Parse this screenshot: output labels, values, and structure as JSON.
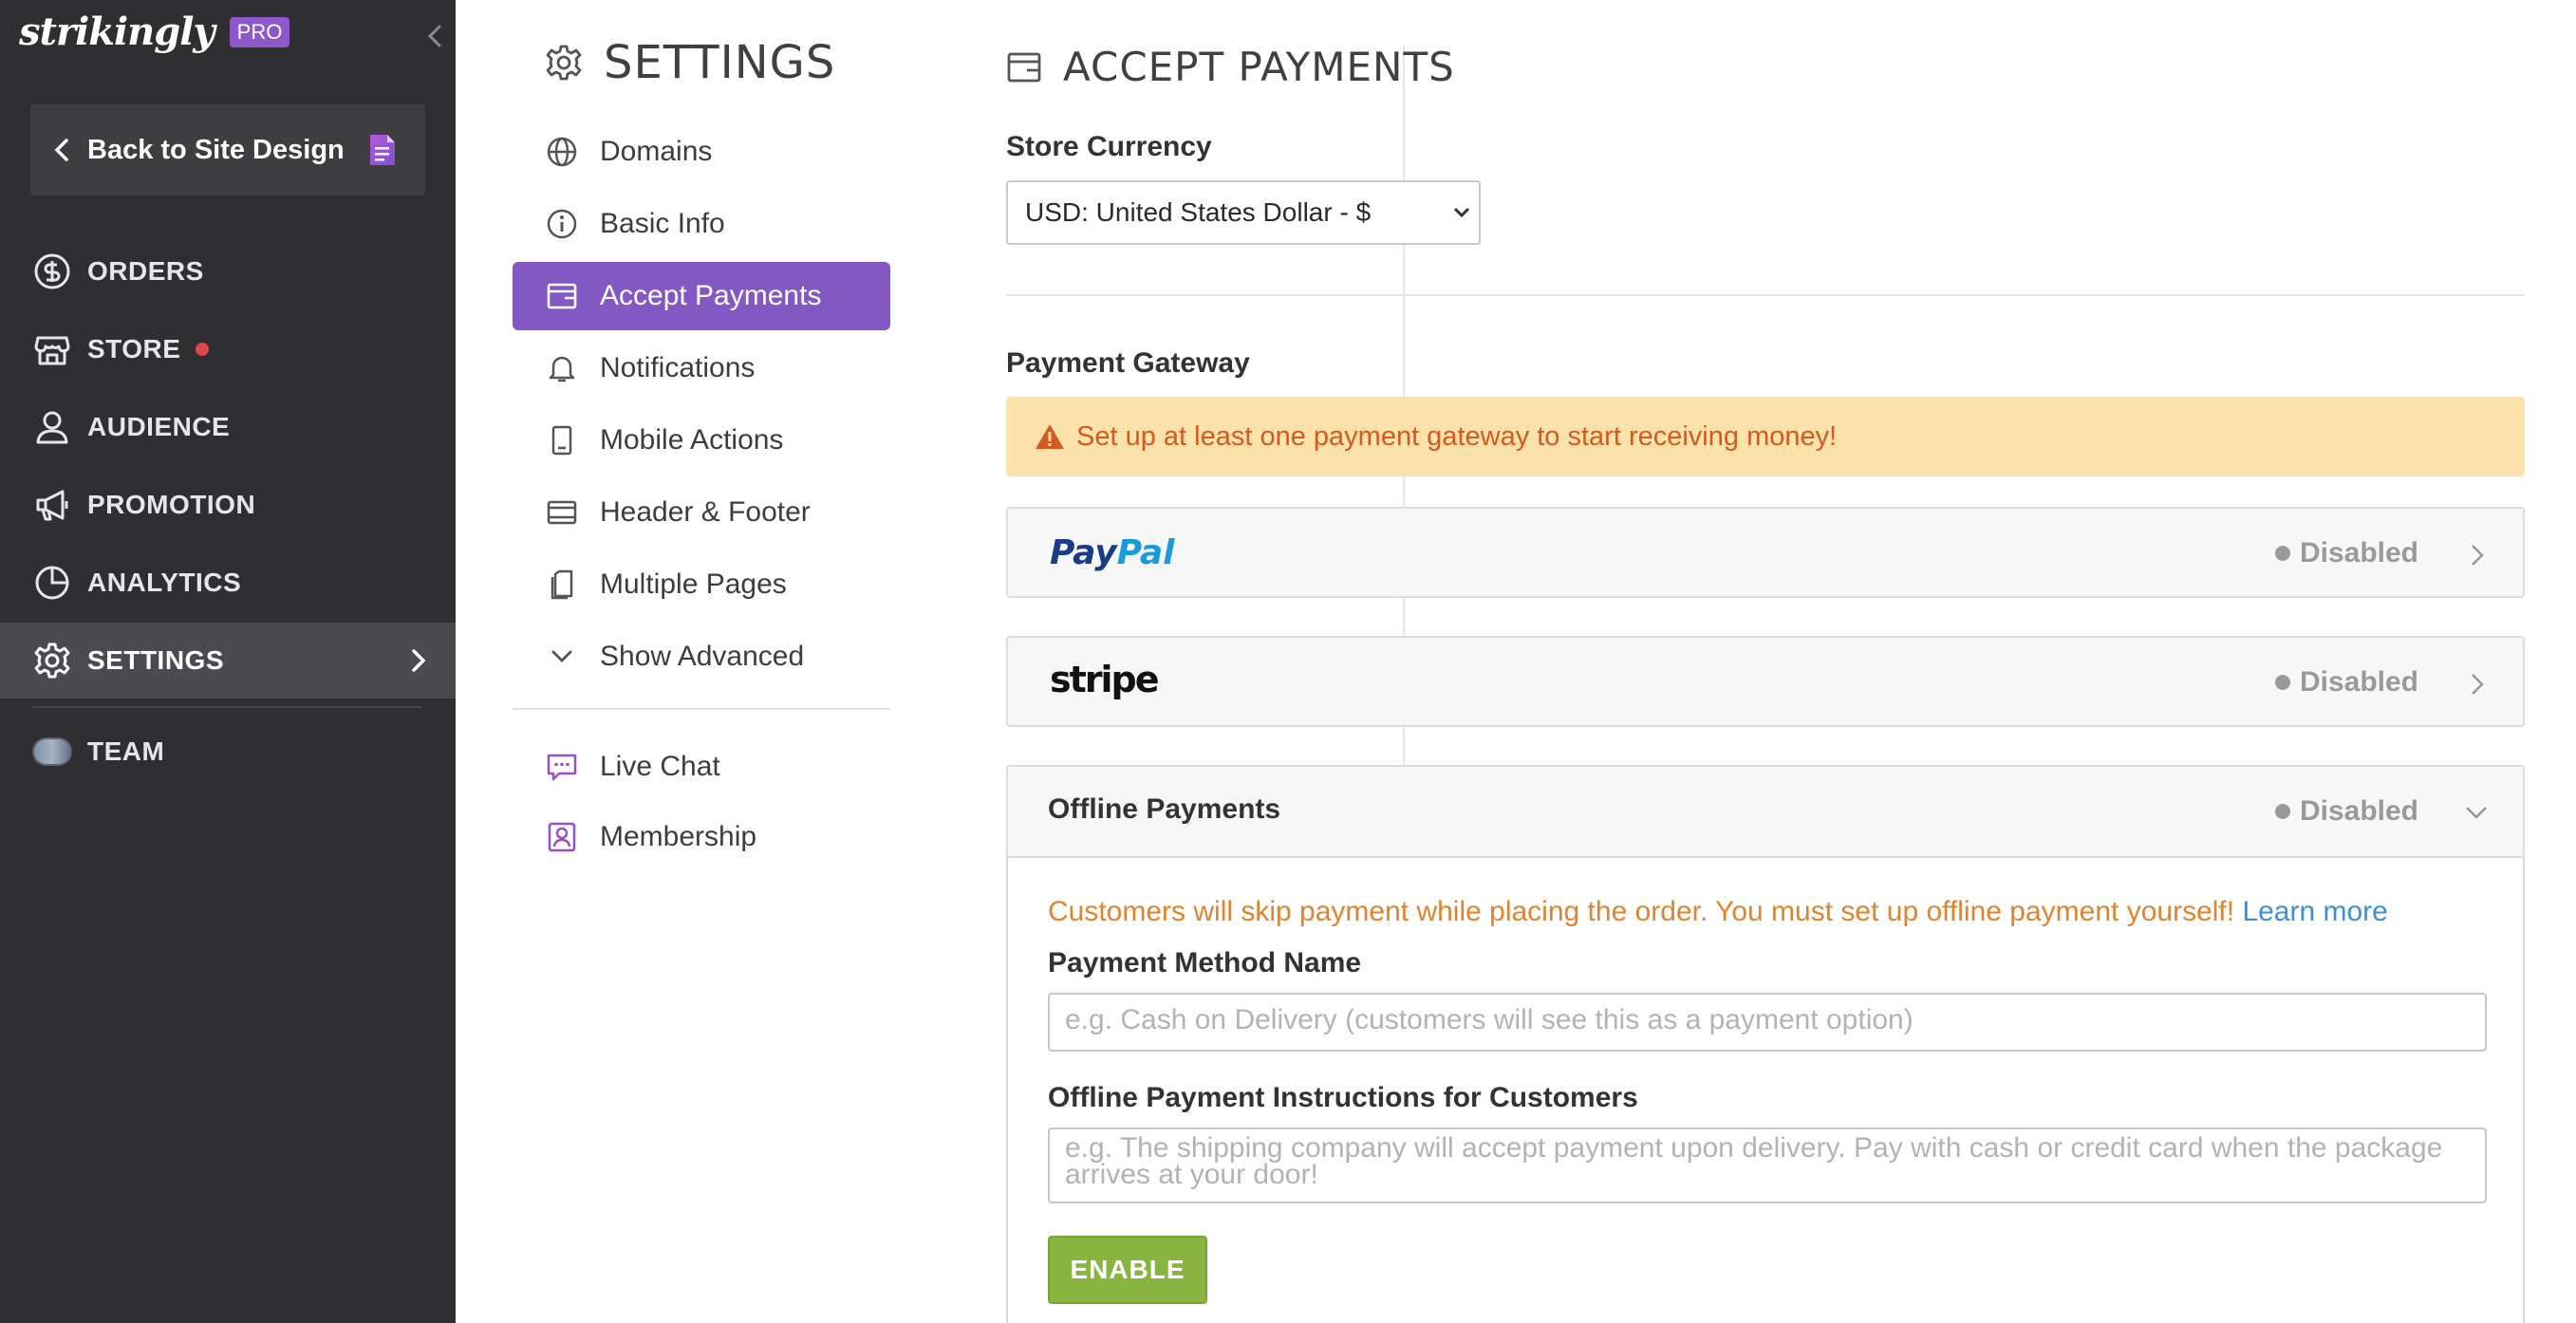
{
  "brand": {
    "logo_text": "strikingly",
    "badge": "PRO"
  },
  "sidebar": {
    "back_label": "Back to Site Design",
    "items": [
      {
        "label": "ORDERS",
        "icon": "dollar-circle-icon"
      },
      {
        "label": "STORE",
        "icon": "storefront-icon",
        "notification_dot": true
      },
      {
        "label": "AUDIENCE",
        "icon": "user-icon"
      },
      {
        "label": "PROMOTION",
        "icon": "megaphone-icon"
      },
      {
        "label": "ANALYTICS",
        "icon": "pie-chart-icon"
      },
      {
        "label": "SETTINGS",
        "icon": "gear-icon",
        "active": true
      },
      {
        "label": "TEAM",
        "icon": "team-avatar"
      }
    ]
  },
  "settings_menu": {
    "title": "SETTINGS",
    "items": [
      {
        "label": "Domains",
        "icon": "globe-icon"
      },
      {
        "label": "Basic Info",
        "icon": "info-icon"
      },
      {
        "label": "Accept Payments",
        "icon": "wallet-icon",
        "active": true
      },
      {
        "label": "Notifications",
        "icon": "bell-icon"
      },
      {
        "label": "Mobile Actions",
        "icon": "mobile-icon"
      },
      {
        "label": "Header & Footer",
        "icon": "layout-icon"
      },
      {
        "label": "Multiple Pages",
        "icon": "pages-icon"
      },
      {
        "label": "Show Advanced",
        "icon": "chevron-down-icon"
      }
    ],
    "extra_items": [
      {
        "label": "Live Chat",
        "icon": "chat-icon"
      },
      {
        "label": "Membership",
        "icon": "membership-icon"
      }
    ]
  },
  "main": {
    "title": "ACCEPT PAYMENTS",
    "store_currency_label": "Store Currency",
    "currency_selected": "USD: United States Dollar - $",
    "payment_gateway_label": "Payment Gateway",
    "warning": "Set up at least one payment gateway to start receiving money!",
    "gateways": [
      {
        "name": "PayPal",
        "status": "Disabled"
      },
      {
        "name": "stripe",
        "status": "Disabled"
      }
    ],
    "offline": {
      "title": "Offline Payments",
      "status": "Disabled",
      "note": "Customers will skip payment while placing the order. You must set up offline payment yourself!",
      "learn_more": "Learn more",
      "method_name_label": "Payment Method Name",
      "method_name_placeholder": "e.g. Cash on Delivery (customers will see this as a payment option)",
      "instructions_label": "Offline Payment Instructions for Customers",
      "instructions_placeholder": "e.g. The shipping company will accept payment upon delivery. Pay with cash or credit card when the package arrives at your door!",
      "enable_label": "ENABLE"
    }
  },
  "colors": {
    "sidebar_bg": "#2f2f31",
    "accent_purple": "#8458c2",
    "warning_bg": "#fbe2ab",
    "warning_text": "#d45a22",
    "note_orange": "#e0832f",
    "link_blue": "#3a90d8",
    "enable_green": "#88b540",
    "alert_red": "#e0474c"
  }
}
